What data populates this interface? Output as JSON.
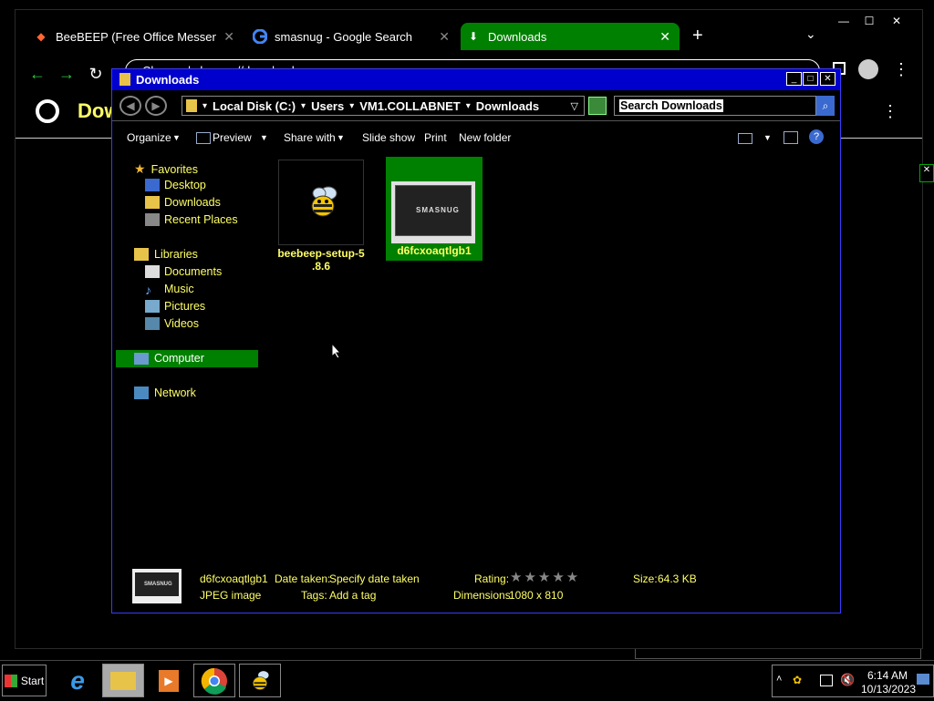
{
  "chrome": {
    "tabs": [
      {
        "label": "BeeBEEP (Free Office Messenger)",
        "icon": "beebeep-tab-icon",
        "active": false
      },
      {
        "label": "smasnug - Google Search",
        "icon": "google-icon",
        "active": false
      },
      {
        "label": "Downloads",
        "icon": "download-icon",
        "active": true
      }
    ],
    "new_tab_symbol": "+",
    "window_controls": {
      "minimize": "—",
      "maximize": "☐",
      "close": "✕"
    },
    "address_partial": "Chrome  |  chrome://downloads",
    "page_heading_partial": "Dow",
    "tab_close": "✕"
  },
  "explorer": {
    "title": "Downloads",
    "breadcrumb": [
      "Local Disk (C:)",
      "Users",
      "VM1.COLLABNET",
      "Downloads"
    ],
    "search_placeholder": "Search Downloads",
    "toolbar": {
      "organize": "Organize",
      "preview": "Preview",
      "share_with": "Share with",
      "slide_show": "Slide show",
      "print": "Print",
      "new_folder": "New folder"
    },
    "nav": {
      "favorites": "Favorites",
      "favorites_items": [
        "Desktop",
        "Downloads",
        "Recent Places"
      ],
      "libraries": "Libraries",
      "libraries_items": [
        "Documents",
        "Music",
        "Pictures",
        "Videos"
      ],
      "computer": "Computer",
      "network": "Network"
    },
    "files": [
      {
        "name_line1": "beebeep-setup-5",
        "name_line2": ".8.6",
        "selected": false
      },
      {
        "name_line1": "d6fcxoaqtlgb1",
        "name_line2": "",
        "selected": true
      }
    ],
    "thumbnail_brand_text": "SMASNUG",
    "details": {
      "filename": "d6fcxoaqtlgb1",
      "filetype": "JPEG image",
      "date_taken_label": "Date taken:",
      "date_taken_value": "Specify date taken",
      "tags_label": "Tags:",
      "tags_value": "Add a tag",
      "rating_label": "Rating:",
      "rating_stars": "★★★★★",
      "dimensions_label": "Dimensions:",
      "dimensions_value": "1080 x 810",
      "size_label": "Size:",
      "size_value": "64.3 KB"
    }
  },
  "taskbar": {
    "start": "Start",
    "time": "6:14 AM",
    "date": "10/13/2023"
  },
  "colors": {
    "accent_green": "#008000",
    "link_yellow": "#ffff66",
    "title_blue": "#0000cc"
  }
}
